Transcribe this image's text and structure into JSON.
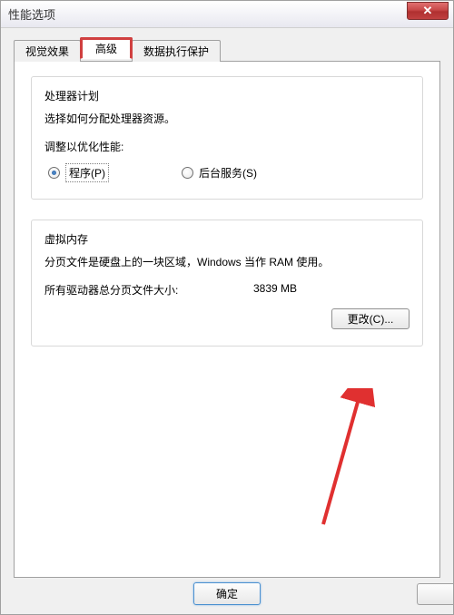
{
  "window": {
    "title": "性能选项",
    "close_symbol": "✕"
  },
  "tabs": {
    "visual_effects": "视觉效果",
    "advanced": "高级",
    "dep": "数据执行保护"
  },
  "processor": {
    "legend": "处理器计划",
    "desc": "选择如何分配处理器资源。",
    "adjust_label": "调整以优化性能:",
    "programs": "程序(P)",
    "background": "后台服务(S)"
  },
  "vm": {
    "legend": "虚拟内存",
    "desc": "分页文件是硬盘上的一块区域，Windows 当作 RAM 使用。",
    "size_label": "所有驱动器总分页文件大小:",
    "size_value": "3839 MB",
    "change_btn": "更改(C)..."
  },
  "buttons": {
    "ok": "确定"
  }
}
